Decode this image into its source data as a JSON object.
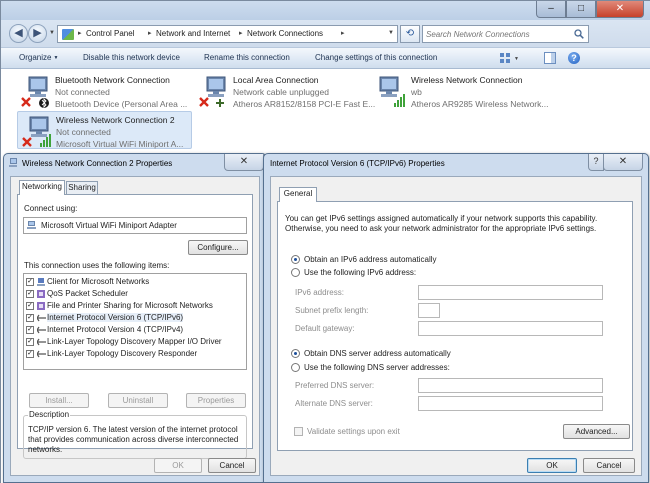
{
  "explorer": {
    "faint_title": "",
    "breadcrumb": [
      "Control Panel",
      "Network and Internet",
      "Network Connections"
    ],
    "search_placeholder": "Search Network Connections",
    "toolbar": {
      "organize": "Organize",
      "disable": "Disable this network device",
      "rename": "Rename this connection",
      "change_settings": "Change settings of this connection"
    },
    "connections": [
      {
        "name": "Bluetooth Network Connection",
        "status": "Not connected",
        "device": "Bluetooth Device (Personal Area ...",
        "icon": "network-adapter-icon"
      },
      {
        "name": "Local Area Connection",
        "status": "Network cable unplugged",
        "device": "Atheros AR8152/8158 PCI-E Fast E...",
        "icon": "network-adapter-icon"
      },
      {
        "name": "Wireless Network Connection",
        "status": "wb",
        "device": "Atheros AR9285 Wireless Network...",
        "icon": "wireless-adapter-icon"
      },
      {
        "name": "Wireless Network Connection 2",
        "status": "Not connected",
        "device": "Microsoft Virtual WiFi Miniport A...",
        "icon": "wireless-adapter-icon"
      }
    ]
  },
  "properties_dialog": {
    "title": "Wireless Network Connection 2 Properties",
    "tabs": [
      "Networking",
      "Sharing"
    ],
    "connect_using_label": "Connect using:",
    "adapter_name": "Microsoft Virtual WiFi Miniport Adapter",
    "configure_label": "Configure...",
    "items_label": "This connection uses the following items:",
    "items": [
      {
        "label": "Client for Microsoft Networks",
        "checked": true
      },
      {
        "label": "QoS Packet Scheduler",
        "checked": true
      },
      {
        "label": "File and Printer Sharing for Microsoft Networks",
        "checked": true
      },
      {
        "label": "Internet Protocol Version 6 (TCP/IPv6)",
        "checked": true
      },
      {
        "label": "Internet Protocol Version 4 (TCP/IPv4)",
        "checked": true
      },
      {
        "label": "Link-Layer Topology Discovery Mapper I/O Driver",
        "checked": true
      },
      {
        "label": "Link-Layer Topology Discovery Responder",
        "checked": true
      }
    ],
    "install_label": "Install...",
    "uninstall_label": "Uninstall",
    "properties_label": "Properties",
    "description_title": "Description",
    "description_lines": [
      "TCP/IP version 6. The latest version of the internet protocol",
      "that provides communication across diverse interconnected",
      "networks."
    ],
    "ok_label": "OK",
    "cancel_label": "Cancel"
  },
  "ipv6_dialog": {
    "title": "Internet Protocol Version 6 (TCP/IPv6) Properties",
    "help_glyph": "?",
    "tab": "General",
    "intro_lines": [
      "You can get IPv6 settings assigned automatically if your network supports this capability.",
      "Otherwise, you need to ask your network administrator for the appropriate IPv6 settings."
    ],
    "obtain_ip_auto": "Obtain an IPv6 address automatically",
    "use_following_ip": "Use the following IPv6 address:",
    "ipv6_address_label": "IPv6 address:",
    "prefix_length_label": "Subnet prefix length:",
    "default_gateway_label": "Default gateway:",
    "obtain_dns_auto": "Obtain DNS server address automatically",
    "use_following_dns": "Use the following DNS server addresses:",
    "preferred_dns_label": "Preferred DNS server:",
    "alternate_dns_label": "Alternate DNS server:",
    "validate_label": "Validate settings upon exit",
    "advanced_label": "Advanced...",
    "ok_label": "OK",
    "cancel_label": "Cancel",
    "ip_mode": "auto",
    "dns_mode": "auto"
  }
}
